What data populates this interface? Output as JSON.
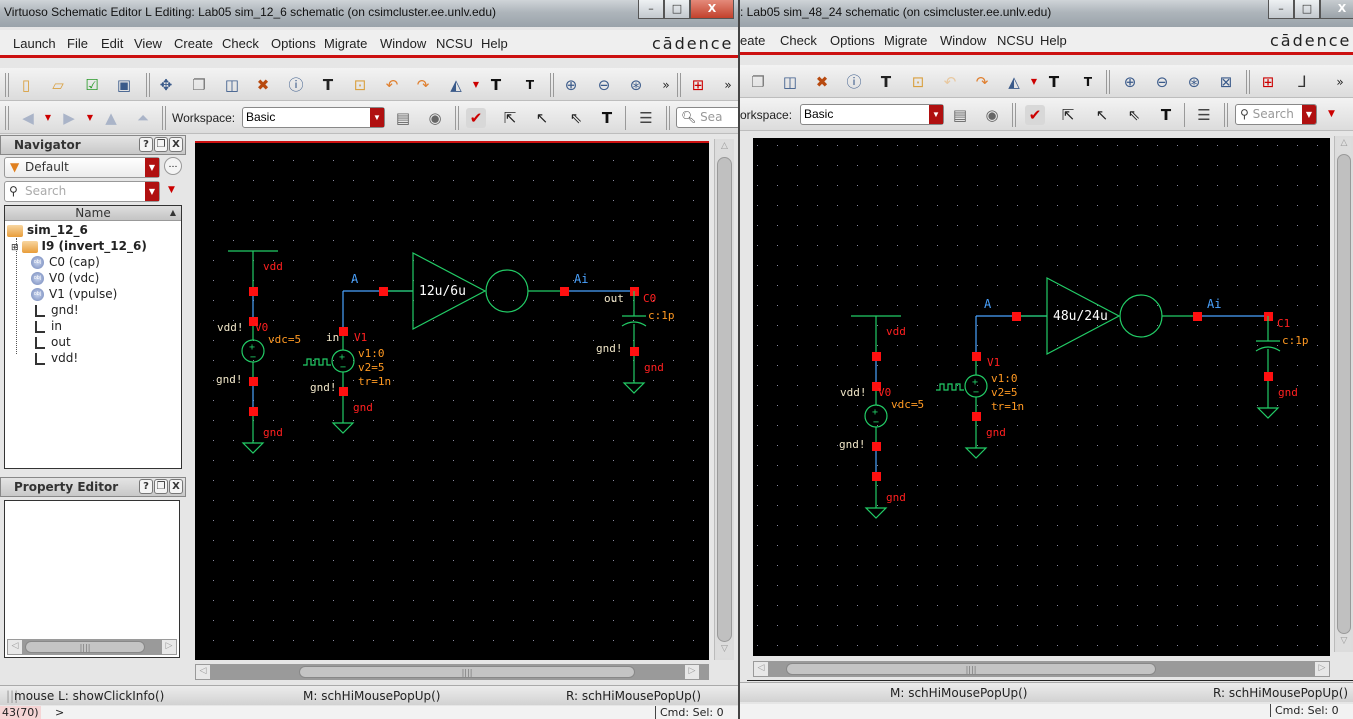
{
  "left_window": {
    "title": "Virtuoso Schematic Editor L Editing: Lab05 sim_12_6 schematic (on csimcluster.ee.unlv.edu)",
    "window_controls": {
      "minimize": "–",
      "maximize": "□",
      "close": "X"
    },
    "menu": [
      "Launch",
      "File",
      "Edit",
      "View",
      "Create",
      "Check",
      "Options",
      "Migrate",
      "Window",
      "NCSU",
      "Help"
    ],
    "brand": "cādence",
    "toolbar2": {
      "workspace_label": "Workspace:",
      "workspace_value": "Basic",
      "search_placeholder": "Sea"
    },
    "navigator": {
      "title": "Navigator",
      "filter_value": "Default",
      "search_placeholder": "Search",
      "column_header": "Name",
      "tree": [
        {
          "label": "sim_12_6",
          "type": "folder",
          "bold": true
        },
        {
          "label": "I9 (invert_12_6)",
          "type": "folder",
          "bold": true
        },
        {
          "label": "C0 (cap)",
          "type": "instance"
        },
        {
          "label": "V0 (vdc)",
          "type": "instance"
        },
        {
          "label": "V1 (vpulse)",
          "type": "instance"
        },
        {
          "label": "gnd!",
          "type": "net"
        },
        {
          "label": "in",
          "type": "net"
        },
        {
          "label": "out",
          "type": "net"
        },
        {
          "label": "vdd!",
          "type": "net"
        }
      ]
    },
    "property_editor": {
      "title": "Property Editor"
    },
    "panel_buttons": {
      "help": "?",
      "float": "❐",
      "close": "X"
    },
    "schematic": {
      "vdd_source": {
        "name": "V0",
        "param": "vdc=5",
        "top_label": "vdd",
        "bottom_label": "gnd",
        "net_top": "vdd!",
        "net_bottom": "gnd!"
      },
      "pulse_source": {
        "name": "V1",
        "params": [
          "v1:0",
          "v2=5",
          "tr=1n"
        ],
        "net_top": "in",
        "net_bottom": "gnd!",
        "bottom_label": "gnd"
      },
      "wire_in_label": "A",
      "inverter_label": "12u/6u",
      "wire_out_label": "Ai",
      "cap": {
        "name": "C0",
        "param": "c:1p",
        "net_top": "out",
        "net_bottom": "gnd!",
        "bottom_label": "gnd"
      }
    },
    "status": {
      "left": "mouse L: showClickInfo()",
      "middle": "M: schHiMousePopUp()",
      "right": "R: schHiMousePopUp()"
    },
    "cmd": {
      "counter": "43(70)",
      "prompt": ">",
      "sel": "Cmd: Sel: 0"
    }
  },
  "right_window": {
    "title": ": Lab05 sim_48_24 schematic (on csimcluster.ee.unlv.edu)",
    "window_controls": {
      "minimize": "–",
      "maximize": "□",
      "close": "X"
    },
    "menu": [
      "eate",
      "Check",
      "Options",
      "Migrate",
      "Window",
      "NCSU",
      "Help"
    ],
    "brand": "cādence",
    "toolbar2": {
      "workspace_label": "orkspace:",
      "workspace_value": "Basic",
      "search_placeholder": "Search"
    },
    "schematic": {
      "vdd_source": {
        "name": "V0",
        "param": "vdc=5",
        "top_label": "vdd",
        "bottom_label": "gnd",
        "net_top": "vdd!",
        "net_bottom": "gnd!"
      },
      "pulse_source": {
        "name": "V1",
        "params": [
          "v1:0",
          "v2=5",
          "tr=1n"
        ],
        "bottom_label": "gnd"
      },
      "wire_in_label": "A",
      "inverter_label": "48u/24u",
      "wire_out_label": "Ai",
      "cap": {
        "name": "C1",
        "param": "c:1p",
        "bottom_label": "gnd"
      }
    },
    "status": {
      "middle": "M: schHiMousePopUp()",
      "right": "R: schHiMousePopUp()"
    },
    "cmd": {
      "sel": "Cmd: Sel: 0"
    }
  },
  "colors": {
    "wire": "#22cc66",
    "selected_wire": "#4aa3ff",
    "pin": "#ff1010",
    "label_red": "#ff2020",
    "label_orange": "#ff9922",
    "label_white": "#f0e6c8",
    "accent_red": "#cc1010"
  }
}
